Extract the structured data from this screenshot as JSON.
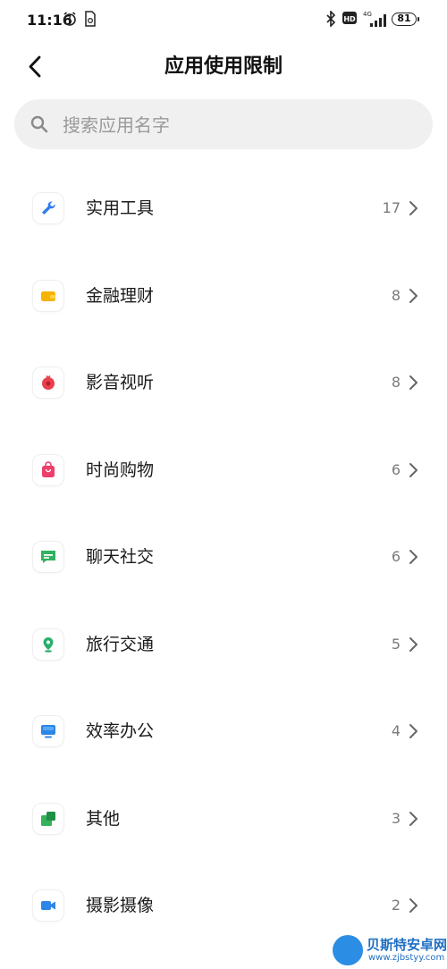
{
  "status_bar": {
    "time": "11:16",
    "network": "4G",
    "hd_badge": "HD",
    "battery": "81",
    "icons": [
      "alarm-icon",
      "file-icon",
      "bluetooth-icon",
      "hd-icon",
      "signal-icon",
      "battery-icon"
    ]
  },
  "header": {
    "title": "应用使用限制",
    "back_icon": "back-arrow-icon"
  },
  "search": {
    "placeholder": "搜索应用名字",
    "value": "",
    "icon": "search-icon"
  },
  "categories": [
    {
      "label": "实用工具",
      "count": "17",
      "icon": "wrench-icon",
      "color": "#2f7bf0"
    },
    {
      "label": "金融理财",
      "count": "8",
      "icon": "wallet-icon",
      "color": "#f6b400"
    },
    {
      "label": "影音视听",
      "count": "8",
      "icon": "media-icon",
      "color": "#e8414d"
    },
    {
      "label": "时尚购物",
      "count": "6",
      "icon": "shopping-bag-icon",
      "color": "#ee3f6a"
    },
    {
      "label": "聊天社交",
      "count": "6",
      "icon": "chat-icon",
      "color": "#2fb35e"
    },
    {
      "label": "旅行交通",
      "count": "5",
      "icon": "location-pin-icon",
      "color": "#27b06c"
    },
    {
      "label": "效率办公",
      "count": "4",
      "icon": "monitor-icon",
      "color": "#2c86e8"
    },
    {
      "label": "其他",
      "count": "3",
      "icon": "other-apps-icon",
      "color": "#35b25a"
    },
    {
      "label": "摄影摄像",
      "count": "2",
      "icon": "camera-icon",
      "color": "#2c86e8"
    }
  ],
  "watermark": {
    "title": "贝斯特安卓网",
    "url": "www.zjbstyy.com"
  }
}
